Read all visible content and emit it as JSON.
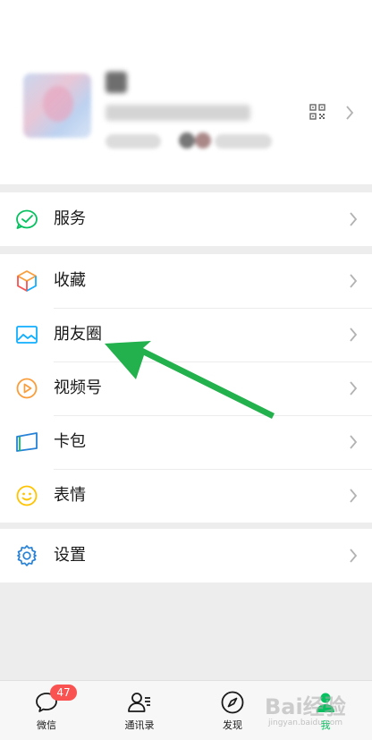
{
  "menu": {
    "group1": [
      {
        "label": "服务",
        "icon": "service-icon"
      }
    ],
    "group2": [
      {
        "label": "收藏",
        "icon": "favorites-icon"
      },
      {
        "label": "朋友圈",
        "icon": "moments-icon"
      },
      {
        "label": "视频号",
        "icon": "channels-icon"
      },
      {
        "label": "卡包",
        "icon": "card-wallet-icon"
      },
      {
        "label": "表情",
        "icon": "sticker-icon"
      }
    ],
    "group3": [
      {
        "label": "设置",
        "icon": "settings-icon"
      }
    ]
  },
  "tabbar": {
    "chats": {
      "label": "微信",
      "badge": "47",
      "icon": "chat-bubble-icon"
    },
    "contacts": {
      "label": "通讯录",
      "icon": "contacts-icon"
    },
    "discover": {
      "label": "发现",
      "icon": "compass-icon"
    },
    "me": {
      "label": "我",
      "icon": "person-icon"
    }
  },
  "colors": {
    "accent_green": "#07c160",
    "arrow_green": "#22b14c",
    "badge_red": "#fa5151",
    "page_bg": "#ededed"
  },
  "watermark": {
    "main": "Bai经验",
    "sub": "jingyan.baidu.com"
  }
}
